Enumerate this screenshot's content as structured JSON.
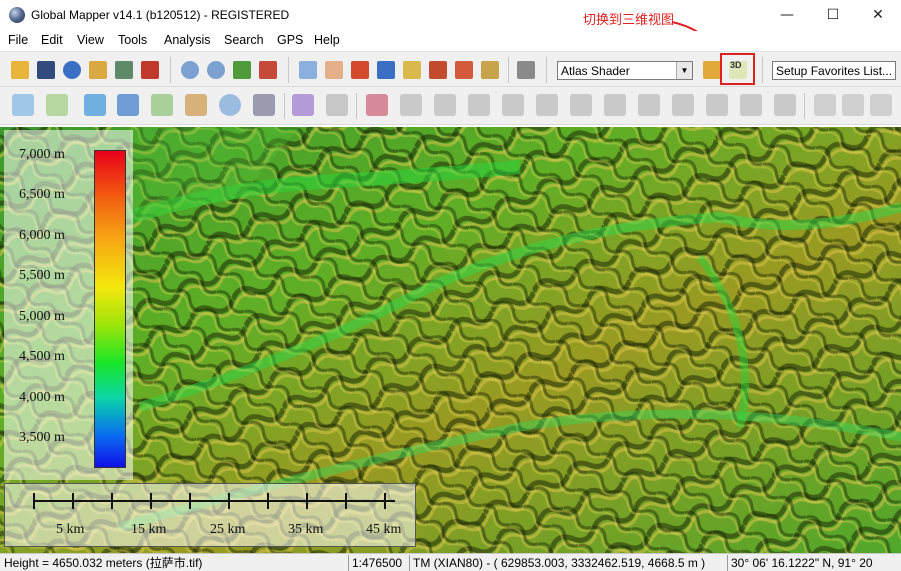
{
  "window": {
    "title": "Global Mapper v14.1 (b120512) - REGISTERED",
    "min_glyph": "—",
    "max_glyph": "☐",
    "close_glyph": "✕"
  },
  "annotation": {
    "callout_text": "切换到三维视图",
    "color": "#e02020"
  },
  "menu": {
    "items": [
      "File",
      "Edit",
      "View",
      "Tools",
      "Analysis",
      "Search",
      "GPS",
      "Help"
    ]
  },
  "toolbar": {
    "shader_select": {
      "value": "Atlas Shader"
    },
    "favorites": {
      "value": "Setup Favorites List..."
    },
    "view_3d_label": "3D"
  },
  "map": {
    "legend": {
      "labels": [
        "7,000 m",
        "6,500 m",
        "6,000 m",
        "5,500 m",
        "5,000 m",
        "4,500 m",
        "4,000 m",
        "3,500 m"
      ]
    },
    "scale_bar": {
      "labels": [
        "5 km",
        "15 km",
        "25 km",
        "35 km",
        "45 km"
      ]
    }
  },
  "status": {
    "height": "Height = 4650.032 meters (拉萨市.tif)",
    "scale": "1:476500",
    "projection": "TM (XIAN80) - ( 629853.003, 3332462.519, 4668.5 m )",
    "coords": "30° 06' 16.1222\" N, 91° 20"
  }
}
